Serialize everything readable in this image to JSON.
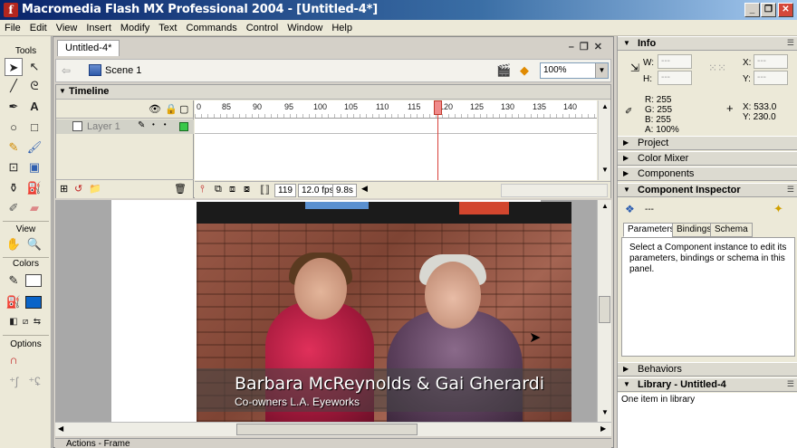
{
  "window": {
    "title": "Macromedia Flash MX Professional 2004 - [Untitled-4*]",
    "buttons": [
      "_",
      "❐",
      "✕"
    ]
  },
  "menu": [
    "File",
    "Edit",
    "View",
    "Insert",
    "Modify",
    "Text",
    "Commands",
    "Control",
    "Window",
    "Help"
  ],
  "tools": {
    "header": "Tools",
    "view_header": "View",
    "colors_header": "Colors",
    "options_header": "Options"
  },
  "document": {
    "tab": "Untitled-4*",
    "scene": "Scene 1",
    "zoom": "100%"
  },
  "timeline": {
    "title": "Timeline",
    "layer_name": "Layer 1",
    "ruler_ticks": [
      "0",
      "85",
      "90",
      "95",
      "100",
      "105",
      "110",
      "115",
      "120",
      "125",
      "130",
      "135",
      "140"
    ],
    "current_frame": "119",
    "fps": "12.0 fps",
    "elapsed": "9.8s"
  },
  "stage": {
    "caption_main": "Barbara McReynolds & Gai Gherardi",
    "caption_sub": "Co-owners L.A. Eyeworks"
  },
  "actions_panel": {
    "title": "Actions - Frame"
  },
  "panels": {
    "info": {
      "title": "Info",
      "w_label": "W:",
      "h_label": "H:",
      "x_label": "X:",
      "y_label": "Y:",
      "r": "R: 255",
      "g": "G: 255",
      "b": "B: 255",
      "a": "A: 100%",
      "cursor_x": "X:  533.0",
      "cursor_y": "Y:  230.0"
    },
    "project": {
      "title": "Project"
    },
    "color_mixer": {
      "title": "Color Mixer"
    },
    "components": {
      "title": "Components"
    },
    "component_inspector": {
      "title": "Component Inspector",
      "instance": "---",
      "tabs": [
        "Parameters",
        "Bindings",
        "Schema"
      ],
      "message": "Select a Component instance to edit its parameters, bindings or schema in this panel."
    },
    "behaviors": {
      "title": "Behaviors"
    },
    "library": {
      "title": "Library - Untitled-4",
      "status": "One item in library"
    }
  }
}
